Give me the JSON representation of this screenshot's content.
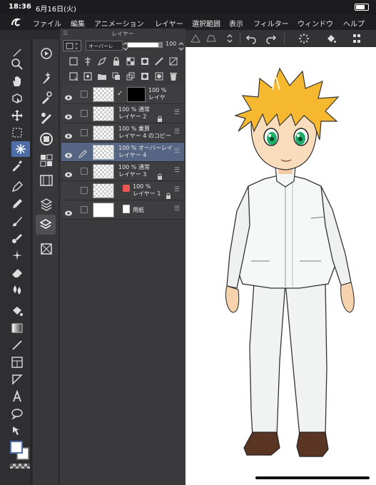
{
  "status": {
    "time": "18:36",
    "date": "6月16日(火)"
  },
  "menu": {
    "items": [
      "ファイル",
      "編集",
      "アニメーション",
      "レイヤー",
      "選択範囲",
      "表示",
      "フィルター",
      "ウィンドウ",
      "ヘルプ"
    ]
  },
  "layer_panel": {
    "title": "レイヤー",
    "blend_mode": "オーバーレ",
    "opacity": "100",
    "layers": [
      {
        "line1": "100 %",
        "line2": "レイヤ",
        "selected": false,
        "checked": true,
        "thumb": "mask"
      },
      {
        "line1": "100 % 通常",
        "line2": "レイヤー 2",
        "selected": false,
        "locked": true
      },
      {
        "line1": "100 % 乗算",
        "line2": "レイヤー 4 のコピー",
        "selected": false
      },
      {
        "line1": "100 % オーバーレイ",
        "line2": "レイヤー 4",
        "selected": true
      },
      {
        "line1": "100 % 通常",
        "line2": "レイヤー 3",
        "selected": false,
        "locked": true
      },
      {
        "line1": "100 %",
        "line2": "レイヤー 1",
        "selected": false,
        "locked": true
      },
      {
        "line1": "",
        "line2": "用紙",
        "selected": false,
        "thumb": "white"
      }
    ]
  },
  "colors": {
    "accent": "#4e6ea8",
    "hair": "#f5b82e",
    "eyes": "#1fae6a",
    "shoes": "#5b3524"
  }
}
